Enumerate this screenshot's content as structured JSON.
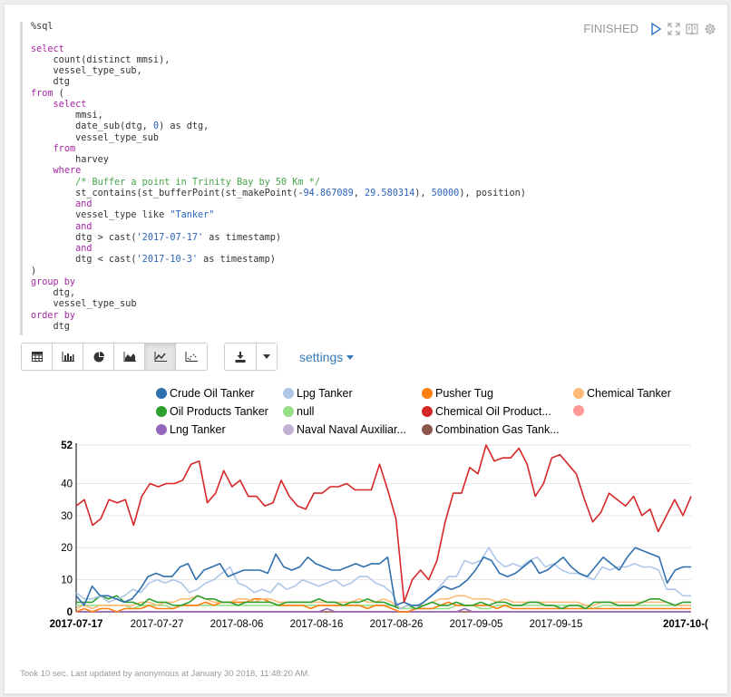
{
  "status": {
    "label": "FINISHED"
  },
  "code_lines": [
    [
      [
        "plain",
        "%sql"
      ]
    ],
    [
      [
        "plain",
        ""
      ]
    ],
    [
      [
        "kw",
        "select"
      ]
    ],
    [
      [
        "plain",
        "    count(distinct mmsi),"
      ]
    ],
    [
      [
        "plain",
        "    vessel_type_sub,"
      ]
    ],
    [
      [
        "plain",
        "    dtg"
      ]
    ],
    [
      [
        "kw",
        "from"
      ],
      [
        "plain",
        " ("
      ]
    ],
    [
      [
        "plain",
        "    "
      ],
      [
        "kw",
        "select"
      ]
    ],
    [
      [
        "plain",
        "        mmsi,"
      ]
    ],
    [
      [
        "plain",
        "        date_sub(dtg, "
      ],
      [
        "num",
        "0"
      ],
      [
        "plain",
        ") as dtg,"
      ]
    ],
    [
      [
        "plain",
        "        vessel_type_sub"
      ]
    ],
    [
      [
        "plain",
        "    "
      ],
      [
        "kw",
        "from"
      ]
    ],
    [
      [
        "plain",
        "        harvey"
      ]
    ],
    [
      [
        "plain",
        "    "
      ],
      [
        "kw",
        "where"
      ]
    ],
    [
      [
        "plain",
        "        "
      ],
      [
        "cm",
        "/* Buffer a point in Trinity Bay by 50 Km */"
      ]
    ],
    [
      [
        "plain",
        "        st_contains(st_bufferPoint(st_makePoint(-"
      ],
      [
        "num",
        "94.867089"
      ],
      [
        "plain",
        ", "
      ],
      [
        "num",
        "29.580314"
      ],
      [
        "plain",
        "), "
      ],
      [
        "num",
        "50000"
      ],
      [
        "plain",
        "), position)"
      ]
    ],
    [
      [
        "plain",
        "        "
      ],
      [
        "kw",
        "and"
      ]
    ],
    [
      [
        "plain",
        "        vessel_type like "
      ],
      [
        "str",
        "\"Tanker\""
      ]
    ],
    [
      [
        "plain",
        "        "
      ],
      [
        "kw",
        "and"
      ]
    ],
    [
      [
        "plain",
        "        dtg > cast("
      ],
      [
        "str",
        "'2017-07-17'"
      ],
      [
        "plain",
        " as timestamp)"
      ]
    ],
    [
      [
        "plain",
        "        "
      ],
      [
        "kw",
        "and"
      ]
    ],
    [
      [
        "plain",
        "        dtg < cast("
      ],
      [
        "str",
        "'2017-10-3'"
      ],
      [
        "plain",
        " as timestamp)"
      ]
    ],
    [
      [
        "plain",
        ")"
      ]
    ],
    [
      [
        "kw",
        "group by"
      ]
    ],
    [
      [
        "plain",
        "    dtg,"
      ]
    ],
    [
      [
        "plain",
        "    vessel_type_sub"
      ]
    ],
    [
      [
        "kw",
        "order by"
      ]
    ],
    [
      [
        "plain",
        "    dtg"
      ]
    ]
  ],
  "toolbar": {
    "views": [
      "table-icon",
      "bar-chart-icon",
      "pie-chart-icon",
      "area-chart-icon",
      "line-chart-icon",
      "scatter-chart-icon"
    ],
    "active_view": 4,
    "settings_label": "settings"
  },
  "legend": [
    {
      "name": "Crude Oil Tanker",
      "color": "#2f6fad"
    },
    {
      "name": "Lpg Tanker",
      "color": "#aec7e8"
    },
    {
      "name": "Pusher Tug",
      "color": "#ff7f0e"
    },
    {
      "name": "Chemical Tanker",
      "color": "#ffbb78"
    },
    {
      "name": "Oil Products Tanker",
      "color": "#2ca02c"
    },
    {
      "name": "null",
      "color": "#98df8a"
    },
    {
      "name": "Chemical Oil Product...",
      "color": "#d62728"
    },
    {
      "name": "",
      "color": "#ff9896"
    },
    {
      "name": "Lng Tanker",
      "color": "#9467bd"
    },
    {
      "name": "Naval Naval Auxiliar...",
      "color": "#c5b0d5"
    },
    {
      "name": "Combination Gas Tank...",
      "color": "#8c564b"
    }
  ],
  "chart_data": {
    "type": "line",
    "x_tick_labels": [
      "2017-07-17",
      "2017-07-27",
      "2017-08-06",
      "2017-08-16",
      "2017-08-26",
      "2017-09-05",
      "2017-09-15",
      "2017-10-("
    ],
    "y_ticks": [
      0,
      10,
      20,
      30,
      40,
      52
    ],
    "ylim": [
      0,
      52
    ],
    "series": [
      {
        "name": "Chemical Oil Product...",
        "color": "#d62728",
        "values": [
          33,
          35,
          27,
          29,
          35,
          34,
          35,
          27,
          36,
          40,
          39,
          40,
          40,
          41,
          46,
          47,
          34,
          37,
          44,
          39,
          41,
          36,
          36,
          33,
          34,
          41,
          36,
          33,
          32,
          37,
          37,
          39,
          39,
          40,
          38,
          38,
          38,
          46,
          38,
          29,
          3,
          10,
          13,
          10,
          16,
          28,
          37,
          37,
          45,
          43,
          52,
          47,
          48,
          48,
          51,
          46,
          36,
          40,
          48,
          49,
          46,
          43,
          35,
          28,
          31,
          37,
          35,
          33,
          36,
          30,
          32,
          25,
          30,
          35,
          30,
          36
        ]
      },
      {
        "name": "Crude Oil Tanker",
        "color": "#2f6fad",
        "values": [
          5,
          2,
          8,
          5,
          5,
          4,
          3,
          4,
          7,
          11,
          12,
          11,
          11,
          14,
          15,
          10,
          13,
          14,
          15,
          11,
          12,
          13,
          13,
          13,
          12,
          18,
          14,
          13,
          14,
          17,
          15,
          14,
          13,
          13,
          14,
          15,
          14,
          15,
          15,
          17,
          2,
          3,
          2,
          2,
          4,
          6,
          8,
          7,
          8,
          10,
          13,
          17,
          16,
          12,
          11,
          12,
          14,
          16,
          12,
          13,
          15,
          17,
          14,
          12,
          11,
          14,
          17,
          15,
          13,
          17,
          20,
          19,
          18,
          17,
          9,
          13,
          14,
          14
        ]
      },
      {
        "name": "Lpg Tanker",
        "color": "#aec7e8",
        "values": [
          6,
          4,
          4,
          5,
          3,
          4,
          5,
          7,
          6,
          9,
          10,
          9,
          10,
          9,
          6,
          7,
          9,
          10,
          12,
          14,
          9,
          8,
          6,
          7,
          6,
          9,
          7,
          8,
          10,
          9,
          8,
          9,
          10,
          8,
          9,
          11,
          11,
          9,
          8,
          6,
          1,
          2,
          2,
          3,
          5,
          8,
          11,
          11,
          16,
          15,
          16,
          20,
          16,
          14,
          15,
          14,
          16,
          17,
          14,
          15,
          13,
          12,
          12,
          11,
          10,
          14,
          13,
          14,
          14,
          15,
          14,
          14,
          13,
          7,
          7,
          5,
          5
        ]
      },
      {
        "name": "Oil Products Tanker",
        "color": "#2ca02c",
        "values": [
          3,
          3,
          3,
          5,
          4,
          5,
          3,
          3,
          2,
          4,
          3,
          3,
          2,
          2,
          3,
          5,
          4,
          4,
          3,
          3,
          2,
          3,
          3,
          3,
          3,
          2,
          3,
          3,
          3,
          3,
          4,
          3,
          3,
          2,
          3,
          3,
          4,
          3,
          3,
          2,
          1,
          2,
          1,
          2,
          3,
          2,
          2,
          3,
          2,
          2,
          3,
          2,
          3,
          3,
          2,
          2,
          3,
          3,
          2,
          2,
          1,
          2,
          2,
          1,
          3,
          3,
          3,
          2,
          2,
          2,
          3,
          4,
          4,
          3,
          2,
          3,
          3
        ]
      },
      {
        "name": "Chemical Tanker",
        "color": "#ffbb78",
        "values": [
          1,
          2,
          1,
          2,
          2,
          2,
          2,
          2,
          3,
          3,
          2,
          3,
          3,
          4,
          4,
          5,
          4,
          3,
          3,
          3,
          4,
          4,
          3,
          4,
          4,
          3,
          3,
          3,
          3,
          3,
          3,
          3,
          3,
          3,
          3,
          4,
          3,
          3,
          4,
          3,
          1,
          2,
          2,
          2,
          3,
          4,
          4,
          5,
          5,
          4,
          4,
          4,
          3,
          4,
          3,
          3,
          3,
          3,
          3,
          3,
          3,
          3,
          3,
          2,
          2,
          3,
          3,
          3,
          3,
          3,
          3,
          3,
          3,
          3,
          2,
          2,
          2
        ]
      },
      {
        "name": "Pusher Tug",
        "color": "#ff7f0e",
        "values": [
          0,
          1,
          0,
          1,
          1,
          0,
          1,
          1,
          1,
          2,
          1,
          1,
          1,
          2,
          2,
          2,
          3,
          2,
          3,
          3,
          3,
          3,
          4,
          4,
          3,
          2,
          2,
          2,
          2,
          1,
          2,
          2,
          2,
          2,
          2,
          2,
          1,
          2,
          2,
          1,
          0,
          0,
          1,
          1,
          1,
          2,
          3,
          2,
          2,
          2,
          2,
          2,
          1,
          2,
          1,
          1,
          1,
          1,
          1,
          1,
          1,
          1,
          1,
          1,
          1,
          1,
          1,
          1,
          1,
          1,
          1,
          1,
          1,
          1,
          1,
          1,
          1
        ]
      },
      {
        "name": "null",
        "color": "#98df8a",
        "values": [
          2,
          2,
          2,
          2,
          2,
          2,
          2,
          1,
          2,
          2,
          2,
          2,
          1,
          2,
          2,
          2,
          2,
          2,
          2,
          2,
          2,
          2,
          2,
          2,
          2,
          2,
          2,
          2,
          2,
          2,
          2,
          2,
          2,
          2,
          2,
          2,
          2,
          2,
          2,
          2,
          1,
          1,
          1,
          1,
          1,
          1,
          1,
          2,
          2,
          2,
          1,
          1,
          2,
          2,
          2,
          2,
          2,
          2,
          2,
          2,
          2,
          2,
          2,
          2,
          1,
          2,
          2,
          2,
          2,
          2,
          2,
          2,
          2,
          2,
          2,
          2,
          2
        ]
      },
      {
        "name": "Lng Tanker",
        "color": "#9467bd",
        "values": [
          0,
          0,
          0,
          0,
          0,
          0,
          0,
          0,
          0,
          0,
          0,
          0,
          0,
          0,
          0,
          0,
          0,
          0,
          0,
          0,
          0,
          0,
          0,
          0,
          0,
          0,
          0,
          0,
          0,
          0,
          0,
          1,
          0,
          0,
          0,
          0,
          0,
          0,
          0,
          0,
          0,
          0,
          0,
          0,
          0,
          0,
          0,
          0,
          1,
          0,
          0,
          0,
          0,
          0,
          0,
          0,
          0,
          0,
          0,
          0,
          0,
          0,
          0,
          0,
          0,
          0,
          0,
          0,
          0,
          0,
          0,
          0,
          0,
          0,
          0,
          0,
          0
        ]
      },
      {
        "name": "Combination Gas Tank...",
        "color": "#8c564b",
        "values": [
          0,
          0,
          0,
          0,
          0,
          0,
          0,
          0,
          0,
          0,
          0,
          0,
          0,
          0,
          0,
          0,
          0,
          0,
          0,
          0,
          0,
          0,
          0,
          0,
          0,
          0,
          0,
          0,
          0,
          0,
          0,
          0,
          0,
          0,
          0,
          0,
          0,
          0,
          0,
          0,
          0,
          0,
          0,
          0,
          0,
          0,
          0,
          0,
          0,
          0,
          0,
          0,
          0,
          0,
          0,
          0,
          0,
          0,
          0,
          0,
          0,
          0,
          0,
          0,
          0,
          0,
          0,
          0,
          0,
          0,
          0,
          0,
          0,
          0,
          0,
          0,
          0
        ]
      }
    ]
  },
  "footer": "Took 10 sec. Last updated by anonymous at January 30 2018, 11:48:20 AM."
}
